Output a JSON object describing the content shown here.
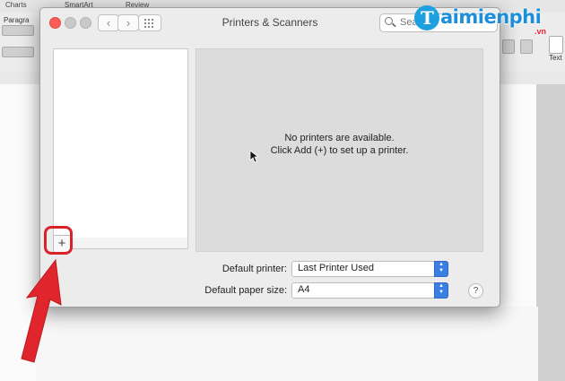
{
  "background_app": {
    "ribbon_tabs": [
      "Charts",
      "SmartArt",
      "Review"
    ],
    "left_label": "Paragra",
    "side_label": "Text"
  },
  "window": {
    "title": "Printers & Scanners",
    "search_placeholder": "Search"
  },
  "printer_list": {
    "add_label": "+"
  },
  "detail": {
    "line1": "No printers are available.",
    "line2": "Click Add (+) to set up a printer."
  },
  "form": {
    "default_printer_label": "Default printer:",
    "default_printer_value": "Last Printer Used",
    "paper_size_label": "Default paper size:",
    "paper_size_value": "A4"
  },
  "help_label": "?",
  "watermark": {
    "text": "aimienphi",
    "sub": ".vn"
  },
  "colors": {
    "accent": "#3b7fe4",
    "annotation": "#d9222a",
    "close_light": "#fc5e57"
  }
}
